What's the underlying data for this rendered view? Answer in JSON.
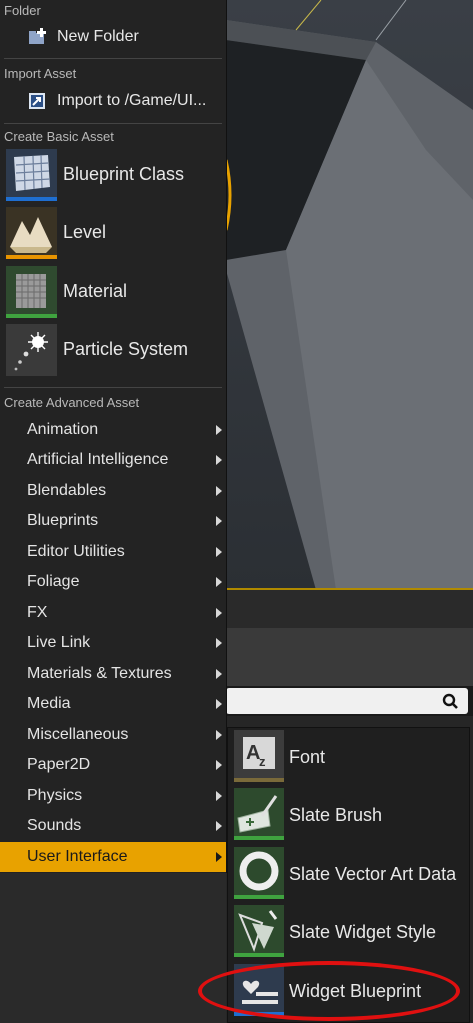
{
  "menu": {
    "folder_header": "Folder",
    "new_folder": "New Folder",
    "import_header": "Import Asset",
    "import_to": "Import to /Game/UI...",
    "basic_header": "Create Basic Asset",
    "basic_items": [
      "Blueprint Class",
      "Level",
      "Material",
      "Particle System"
    ],
    "advanced_header": "Create Advanced Asset",
    "advanced_items": [
      "Animation",
      "Artificial Intelligence",
      "Blendables",
      "Blueprints",
      "Editor Utilities",
      "Foliage",
      "FX",
      "Live Link",
      "Materials & Textures",
      "Media",
      "Miscellaneous",
      "Paper2D",
      "Physics",
      "Sounds",
      "User Interface"
    ],
    "active_item": "User Interface"
  },
  "submenu": {
    "items": [
      "Font",
      "Slate Brush",
      "Slate Vector Art Data",
      "Slate Widget Style",
      "Widget Blueprint"
    ],
    "highlighted": "Widget Blueprint"
  },
  "colors": {
    "accent": "#e8a200",
    "highlight_ring": "#e01010",
    "blueprint_bar": "#1f6fd1",
    "level_bar": "#e89400",
    "material_bar": "#3fa33f"
  },
  "icons": {
    "search": "search-icon",
    "new_folder": "new-folder-icon",
    "import": "import-icon"
  }
}
